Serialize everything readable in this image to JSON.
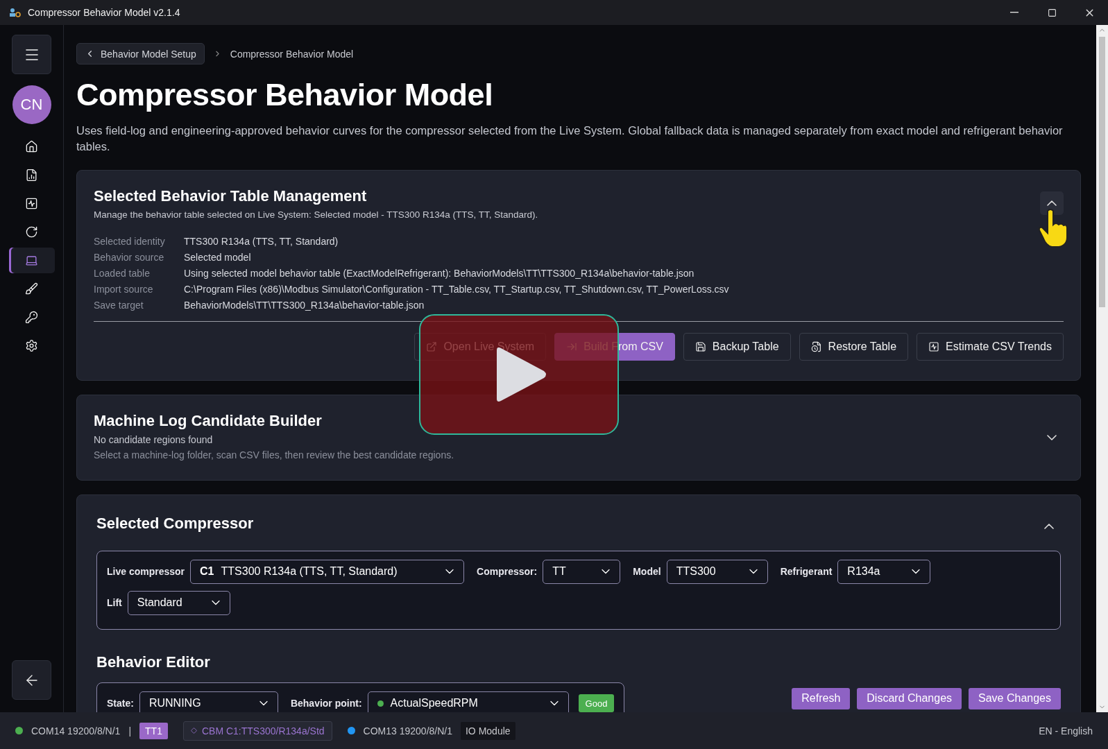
{
  "window": {
    "title": "Compressor Behavior Model v2.1.4"
  },
  "sidebar": {
    "avatar": "CN",
    "items": [
      {
        "selected": false
      },
      {
        "selected": false
      },
      {
        "selected": false
      },
      {
        "selected": false
      },
      {
        "selected": true
      },
      {
        "selected": false
      },
      {
        "selected": false
      },
      {
        "selected": false
      }
    ]
  },
  "breadcrumb": {
    "back": "Behavior Model Setup",
    "current": "Compressor Behavior Model"
  },
  "page": {
    "title": "Compressor Behavior Model",
    "description": "Uses field-log and engineering-approved behavior curves for the compressor selected from the Live System. Global fallback data is managed separately from exact model and refrigerant behavior tables."
  },
  "table_management": {
    "title": "Selected Behavior Table Management",
    "subtitle": "Manage the behavior table selected on Live System: Selected model - TTS300 R134a (TTS, TT, Standard).",
    "expanded": true,
    "details": [
      {
        "label": "Selected identity",
        "value": "TTS300 R134a (TTS, TT, Standard)"
      },
      {
        "label": "Behavior source",
        "value": "Selected model"
      },
      {
        "label": "Loaded table",
        "value": "Using selected model behavior table (ExactModelRefrigerant): BehaviorModels\\TT\\TTS300_R134a\\behavior-table.json"
      },
      {
        "label": "Import source",
        "value": "C:\\Program Files (x86)\\Modbus Simulator\\Configuration - TT_Table.csv, TT_Startup.csv, TT_Shutdown.csv, TT_PowerLoss.csv"
      },
      {
        "label": "Save target",
        "value": "BehaviorModels\\TT\\TTS300_R134a\\behavior-table.json"
      }
    ],
    "actions": [
      {
        "label": "Open Live System",
        "primary": false
      },
      {
        "label": "Build From CSV",
        "primary": true
      },
      {
        "label": "Backup Table",
        "primary": false
      },
      {
        "label": "Restore Table",
        "primary": false
      },
      {
        "label": "Estimate CSV Trends",
        "primary": false
      }
    ]
  },
  "candidate_builder": {
    "title": "Machine Log Candidate Builder",
    "status": "No candidate regions found",
    "hint": "Select a machine-log folder, scan CSV files, then review the best candidate regions.",
    "expanded": false
  },
  "selected_compressor": {
    "title": "Selected Compressor",
    "expanded": true,
    "fields": [
      {
        "label": "Live compressor",
        "tag": "C1",
        "value": "TTS300 R134a (TTS, TT, Standard)"
      },
      {
        "label": "Compressor:",
        "value": "TT"
      },
      {
        "label": "Model",
        "value": "TTS300"
      },
      {
        "label": "Refrigerant",
        "value": "R134a"
      },
      {
        "label": "Lift",
        "value": "Standard"
      }
    ]
  },
  "behavior_editor": {
    "title": "Behavior Editor",
    "state": {
      "label": "State:",
      "value": "RUNNING"
    },
    "point": {
      "label": "Behavior point:",
      "value": "ActualSpeedRPM",
      "color": "#4caf50"
    },
    "quality": "Good",
    "buttons": [
      "Refresh",
      "Discard Changes",
      "Save Changes"
    ]
  },
  "status_bar": {
    "items": [
      {
        "kind": "port",
        "text": "COM14 19200/8/N/1",
        "color": "#4caf50"
      },
      {
        "kind": "separator",
        "text": "|"
      },
      {
        "kind": "badge",
        "text": "TT1"
      },
      {
        "kind": "tag",
        "text": "CBM C1:TTS300/R134a/Std"
      },
      {
        "kind": "port",
        "text": "COM13 19200/8/N/1",
        "color": "#2196f3"
      },
      {
        "kind": "label",
        "text": "IO Module"
      }
    ],
    "language": "EN - English"
  }
}
